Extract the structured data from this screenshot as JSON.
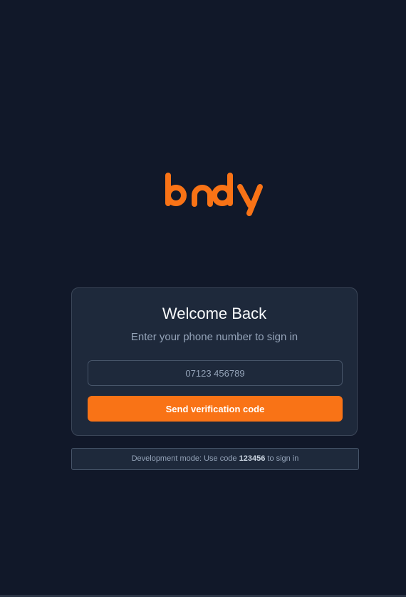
{
  "brand": {
    "logo_text": "bndy",
    "color": "#f97316"
  },
  "login_card": {
    "title": "Welcome Back",
    "subtitle": "Enter your phone number to sign in",
    "phone_input": {
      "value": "",
      "placeholder": "07123 456789"
    },
    "submit_label": "Send verification code"
  },
  "dev_notice": {
    "prefix": "Development mode: Use code ",
    "code": "123456",
    "suffix": " to sign in"
  },
  "colors": {
    "background": "#111829",
    "card": "#1e293b",
    "accent": "#f97316"
  }
}
